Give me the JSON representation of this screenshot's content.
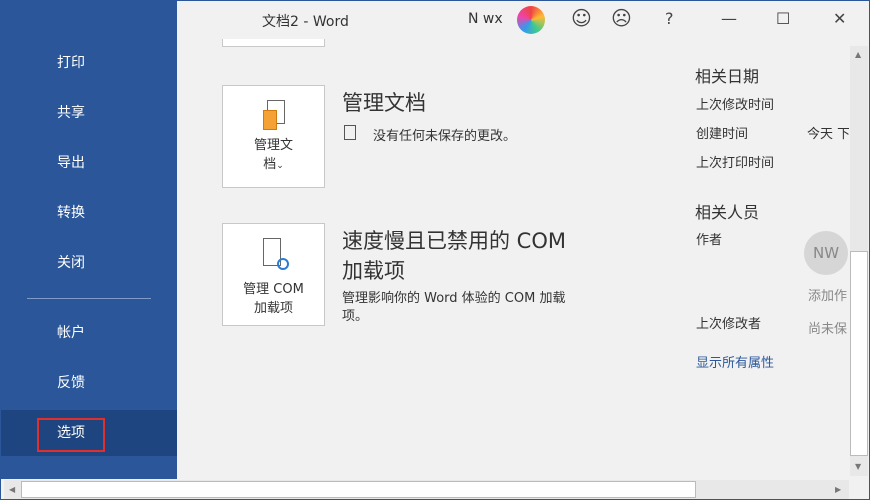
{
  "window": {
    "title": "文档2  -  Word",
    "user": "N wx",
    "help": "?",
    "minimize": "—",
    "maximize": "☐",
    "close": "✕",
    "smile": "☺",
    "frown": "☹"
  },
  "sidebar": {
    "items": [
      "打印",
      "共享",
      "导出",
      "转换",
      "关闭",
      "帐户",
      "反馈",
      "选项"
    ]
  },
  "manage": {
    "button_line1": "管理文",
    "button_line2": "档",
    "heading": "管理文档",
    "status": "没有任何未保存的更改。"
  },
  "com": {
    "button_line1": "管理 COM",
    "button_line2": "加载项",
    "heading_line1": "速度慢且已禁用的 COM",
    "heading_line2": "加载项",
    "desc_line1": "管理影响你的 Word 体验的 COM 加载",
    "desc_line2": "项。"
  },
  "properties": {
    "dates_heading": "相关日期",
    "last_modified": "上次修改时间",
    "created": "创建时间",
    "created_value": "今天 下",
    "last_printed": "上次打印时间",
    "people_heading": "相关人员",
    "author": "作者",
    "author_initials": "NW",
    "add_author": "添加作",
    "last_modified_by": "上次修改者",
    "last_modified_by_value": "尚未保",
    "show_all": "显示所有属性"
  },
  "colors": {
    "sidebar": "#2b579a",
    "selected": "#1e4580",
    "highlight": "#e0302d",
    "link": "#2b579a"
  }
}
